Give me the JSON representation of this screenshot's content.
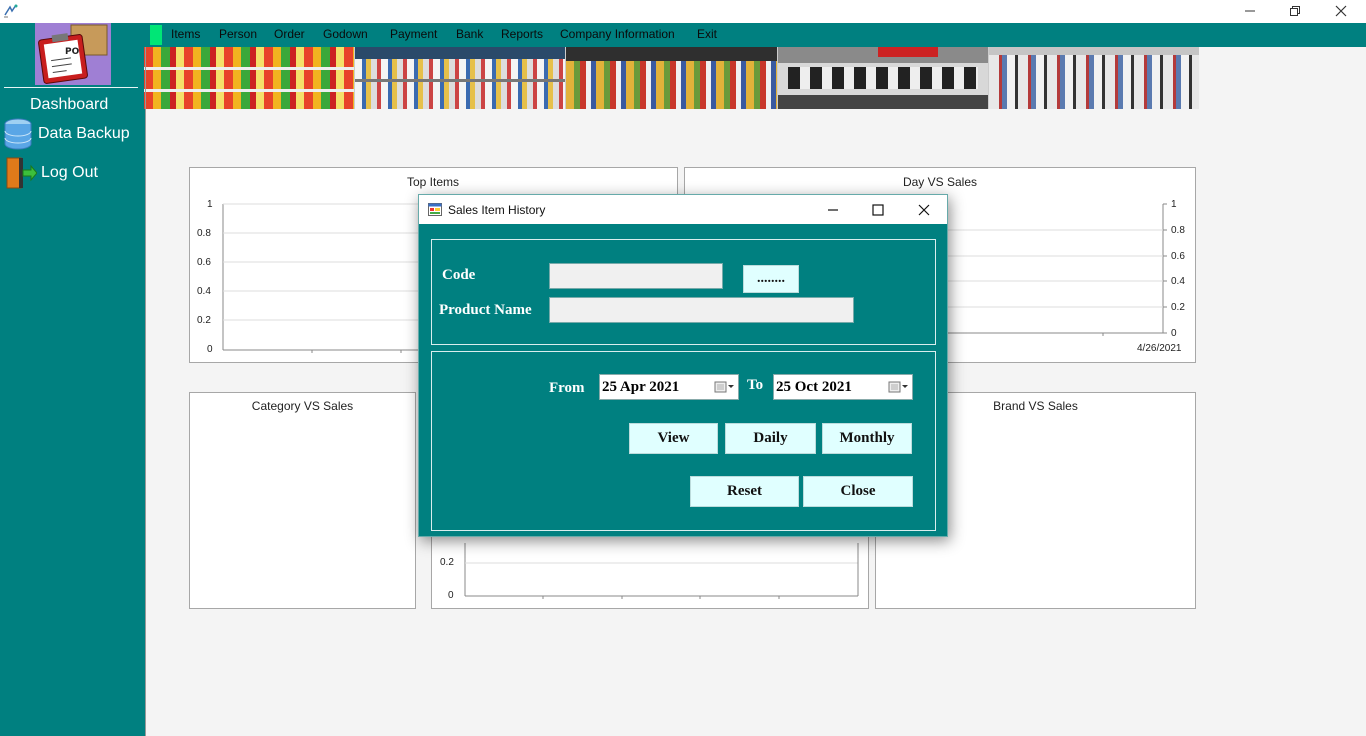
{
  "window": {
    "minimize_icon": "minimize-icon",
    "restore_icon": "restore-icon",
    "close_icon": "close-icon"
  },
  "sidebar": {
    "items": [
      {
        "label": "Dashboard",
        "icon": ""
      },
      {
        "label": "Data Backup",
        "icon": "database-icon"
      },
      {
        "label": "Log Out",
        "icon": "door-exit-icon"
      }
    ],
    "logo_text": "PO"
  },
  "menu": {
    "items": [
      "Items",
      "Person",
      "Order",
      "Godown",
      "Payment",
      "Bank",
      "Reports",
      "Company Information",
      "Exit"
    ]
  },
  "charts": {
    "top_items": {
      "title": "Top Items",
      "yticks": [
        "1",
        "0.8",
        "0.6",
        "0.4",
        "0.2",
        "0"
      ]
    },
    "day_vs_sales": {
      "title": "Day VS Sales",
      "yticks": [
        "1",
        "0.8",
        "0.6",
        "0.4",
        "0.2",
        "0"
      ],
      "x_label": "4/26/2021"
    },
    "category_vs_sales": {
      "title": "Category VS Sales"
    },
    "brand_vs_sales": {
      "title": "Brand VS Sales"
    },
    "middle": {
      "yticks": [
        "0.2",
        "0"
      ]
    }
  },
  "dialog": {
    "title": "Sales Item History",
    "code_label": "Code",
    "code_value": "",
    "browse_label": "........",
    "product_label": "Product Name",
    "product_value": "",
    "from_label": "From",
    "from_date": "25  Apr  2021",
    "to_label": "To",
    "to_date": "25  Oct  2021",
    "view_label": "View",
    "daily_label": "Daily",
    "monthly_label": "Monthly",
    "reset_label": "Reset",
    "close_label": "Close"
  },
  "colors": {
    "teal": "#008080",
    "accent_green": "#00e676",
    "button_bg": "#e0ffff"
  }
}
